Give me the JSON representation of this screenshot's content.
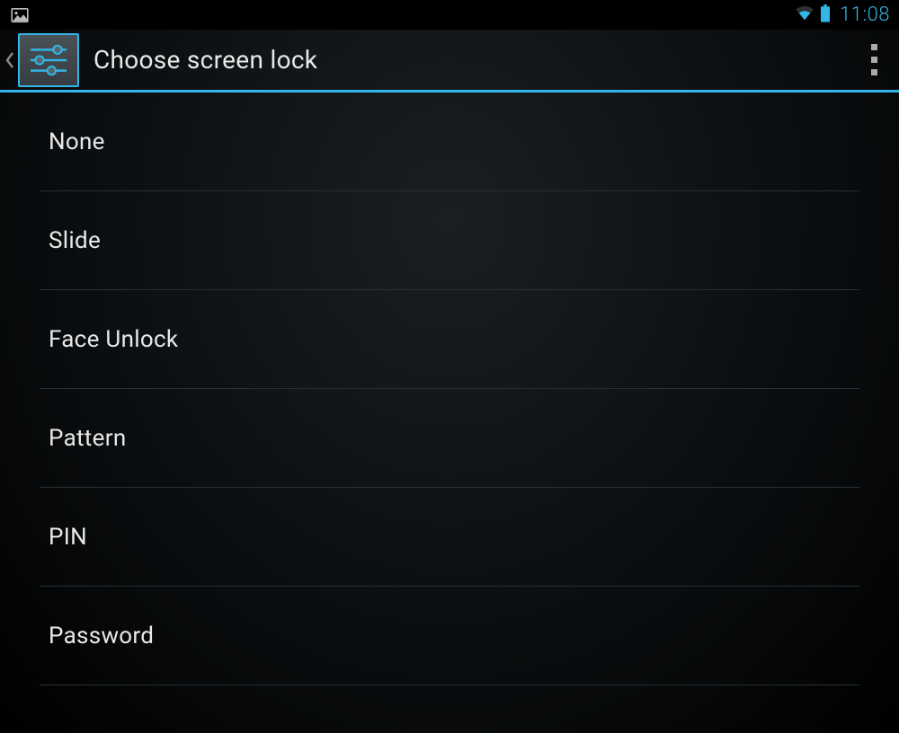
{
  "status": {
    "time": "11:08"
  },
  "header": {
    "title": "Choose screen lock"
  },
  "options": [
    {
      "label": "None"
    },
    {
      "label": "Slide"
    },
    {
      "label": "Face Unlock"
    },
    {
      "label": "Pattern"
    },
    {
      "label": "PIN"
    },
    {
      "label": "Password"
    }
  ],
  "colors": {
    "accent": "#33b5e5"
  }
}
